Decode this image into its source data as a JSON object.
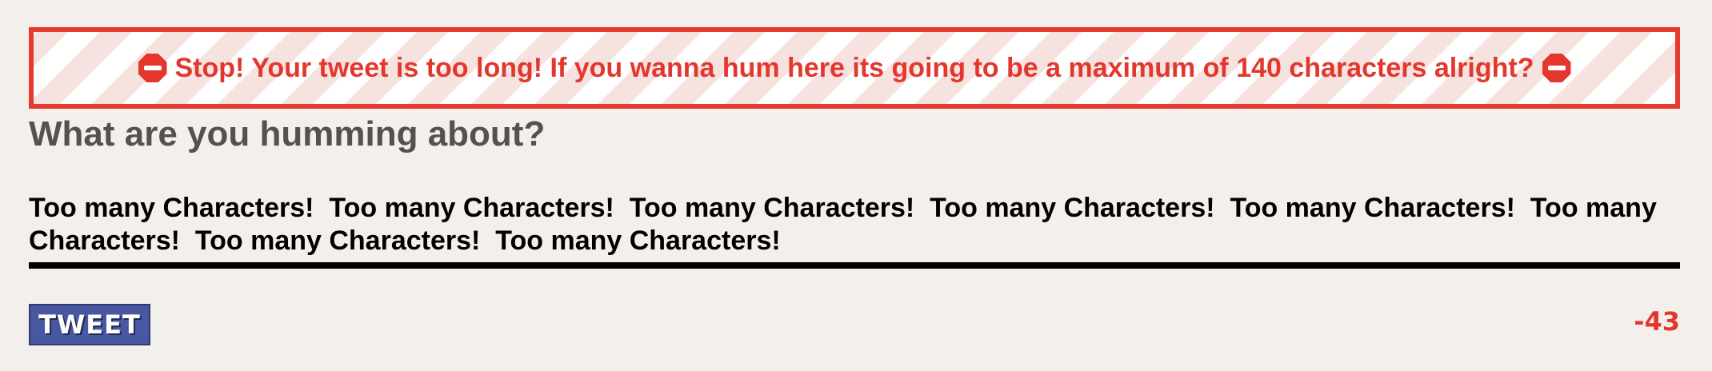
{
  "alert": {
    "icon_left": "stop-sign-icon",
    "message": "Stop! Your tweet is too long! If you wanna hum here its going to be a maximum of 140 characters alright?",
    "icon_right": "stop-sign-icon",
    "color": "#e3372e"
  },
  "compose": {
    "prompt": "What are you humming about?",
    "text": "Too many Characters!  Too many Characters!  Too many Characters!  Too many Characters!  Too many Characters!  Too many Characters!  Too many Characters!  Too many Characters!"
  },
  "footer": {
    "tweet_label": "TWEET",
    "char_counter": "-43",
    "button_color": "#4957a1",
    "counter_color": "#e3372e"
  }
}
